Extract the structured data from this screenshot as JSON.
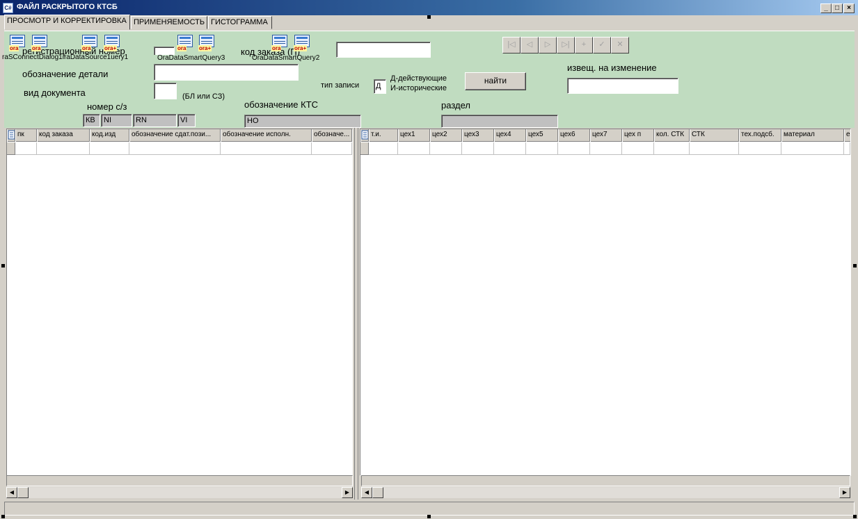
{
  "window": {
    "app_icon": "C#",
    "title": "ФАЙЛ РАСКРЫТОГО КТСБ",
    "minimize": "_",
    "maximize": "□",
    "close": "×"
  },
  "tabs": [
    {
      "label": "ПРОСМОТР И КОРРЕКТИРОВКА",
      "active": true
    },
    {
      "label": "ПРИМЕНЯЕМОСТЬ",
      "active": false
    },
    {
      "label": "ГИСТОГРАММА",
      "active": false
    }
  ],
  "form": {
    "reg_number_label": "регистрационный номер",
    "order_code_label": "код заказа (П)",
    "order_code_value": "",
    "detail_label": "обозначение детали",
    "detail_value": "",
    "doc_type_label": "вид документа",
    "doc_type_value": "",
    "doc_type_hint": "(БЛ или СЗ)",
    "record_type_label": "тип записи",
    "record_type_value": "Д",
    "record_type_option1": "Д-действующие",
    "record_type_option2": "И-исторические",
    "find_button": "найти",
    "notice_label": "извещ. на изменение",
    "notice_value": "",
    "sz_number_label": "номер с/з",
    "sz_parts": [
      "КВ",
      "NI",
      "RN",
      "VI"
    ],
    "kts_label": "обозначение КТС",
    "kts_value": "НО",
    "section_label": "раздел",
    "section_value": ""
  },
  "components": {
    "c1": {
      "tag": "ora"
    },
    "c2": {
      "tag": "ora"
    },
    "c3": {
      "tag": "ora"
    },
    "c4": {
      "tag": "ora+"
    },
    "c5": {
      "tag": "ora"
    },
    "c6": {
      "tag": "ora+"
    },
    "c7": {
      "tag": "ora"
    },
    "c8": {
      "tag": "ora+"
    },
    "caption_left": "raSConnectDialog1iraDataSource1uery1",
    "caption_mid": "OraDataSmartQuery3",
    "caption_right": "OraDataSmartQuery2"
  },
  "navigator": [
    "|◁",
    "◁",
    "▷",
    "▷|",
    "+",
    "✓",
    "✕"
  ],
  "grid_left": {
    "corner_icon": "grid-settings-icon",
    "columns": [
      "пк",
      "код заказа",
      "код.изд",
      "обозначение сдат.пози...",
      "обозначение исполн.",
      "обозначе..."
    ]
  },
  "grid_right": {
    "corner_icon": "grid-settings-icon",
    "columns": [
      "т.и.",
      "цех1",
      "цех2",
      "цех3",
      "цех4",
      "цех5",
      "цех6",
      "цех7",
      "цех п",
      "кол.  СТК",
      "СТК",
      "тех.подсб.",
      "материал",
      "е"
    ]
  },
  "scroll": {
    "left_arrow": "◀",
    "right_arrow": "▶"
  }
}
